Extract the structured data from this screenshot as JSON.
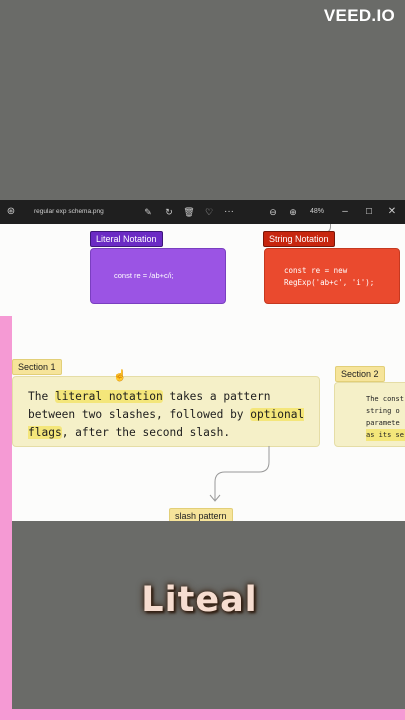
{
  "watermark": "VEED.IO",
  "toolbar": {
    "file_name": "regular exp schema.png",
    "zoom": "48%",
    "icons": [
      "app-icon",
      "edit-icon",
      "rotate-icon",
      "delete-icon",
      "heart-icon",
      "more-icon",
      "zoom-out-icon",
      "zoom-in-icon",
      "minimize-icon",
      "maximize-icon",
      "close-icon"
    ]
  },
  "diagram": {
    "literal_tag": "Literal Notation",
    "literal_code": "const re = /ab+c/i;",
    "string_tag": "String Notation",
    "string_code_line1": "const re = new",
    "string_code_line2": "RegExp('ab+c', 'i');",
    "section1": {
      "tag": "Section 1",
      "t1": "The ",
      "h1": "literal notation",
      "t2": " takes a pattern between two slashes, followed by ",
      "h2": "optional flags",
      "t3": ", after the second slash."
    },
    "section2": {
      "tag": "Section 2",
      "l1": "The const",
      "l2": "string o",
      "l3": "paramete",
      "l4": "as its se"
    },
    "slash_tag": "slash pattern"
  },
  "caption": "Liteal",
  "colors": {
    "literal": "#9b54e4",
    "string": "#ea4a2e",
    "section": "#f5f0c8",
    "highlight": "#f4e67a",
    "pink": "#f59ad4"
  }
}
